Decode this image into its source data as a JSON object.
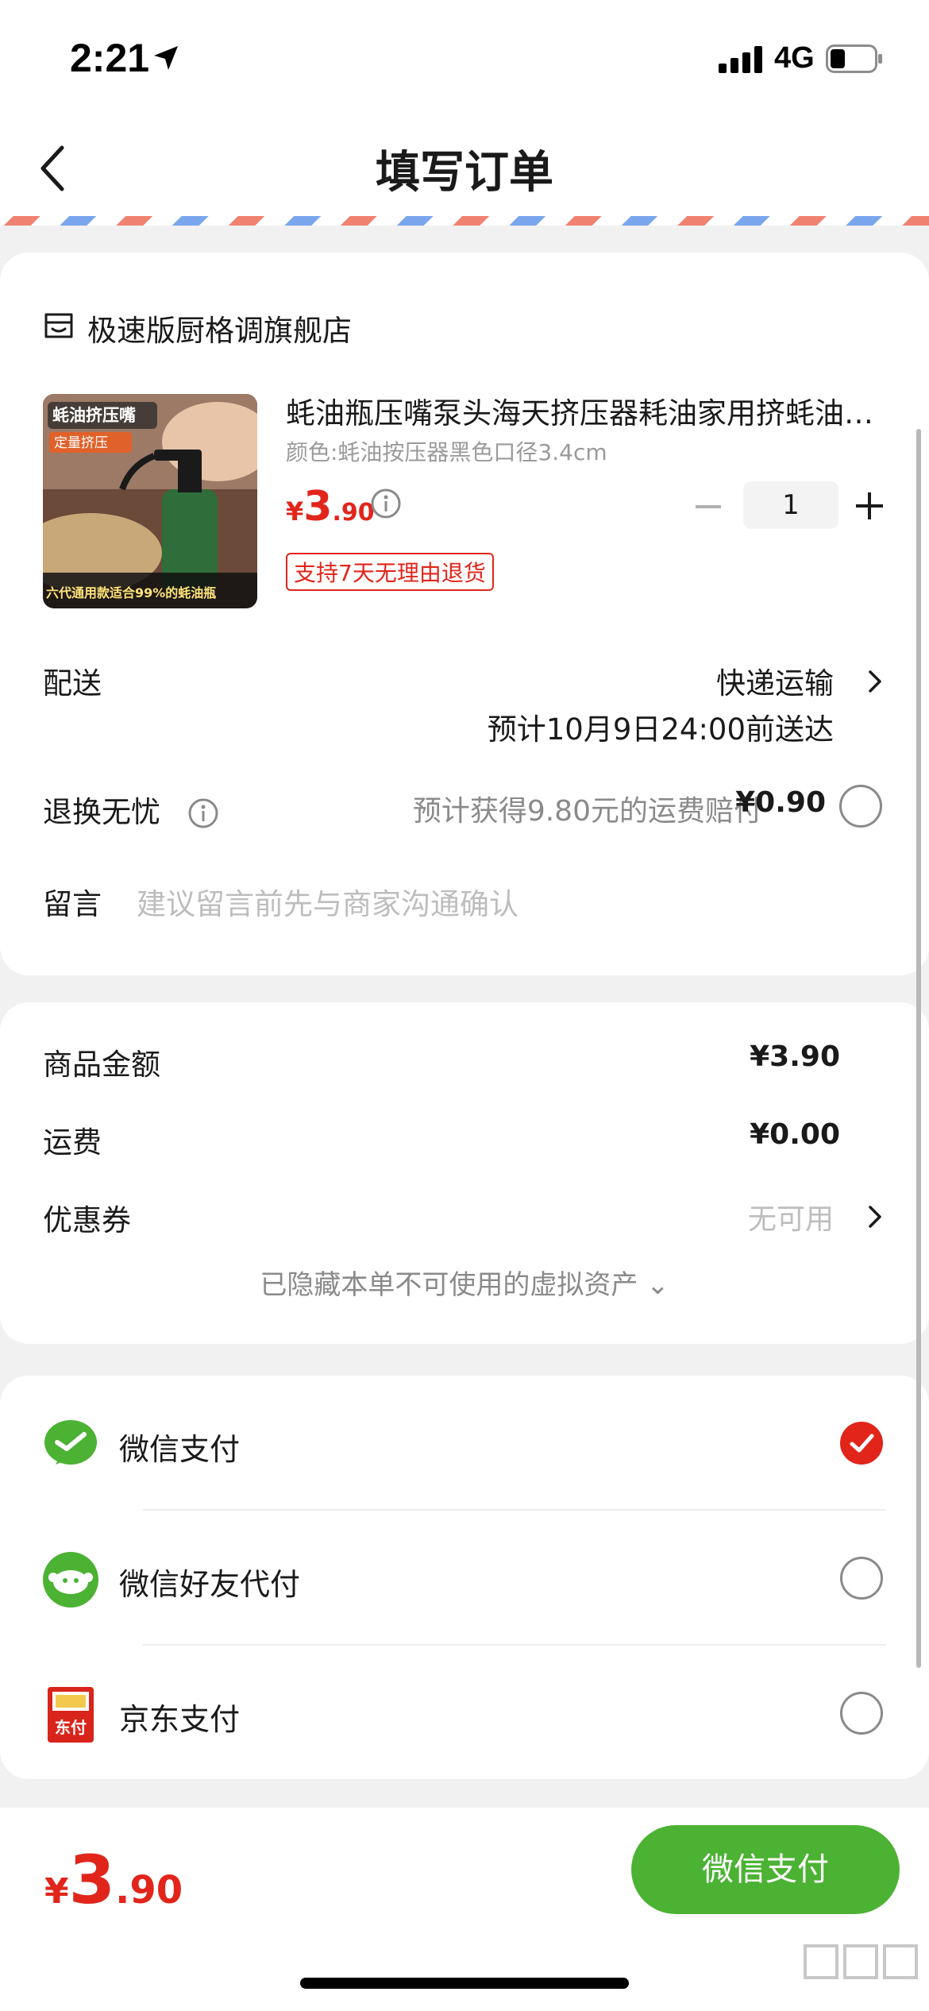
{
  "status_bar": {
    "time": "2:21",
    "network": "4G"
  },
  "nav": {
    "title": "填写订单"
  },
  "shop": {
    "name": "极速版厨格调旗舰店"
  },
  "product": {
    "title": "蚝油瓶压嘴泵头海天挤压器耗油家用挤蚝油神器",
    "spec": "颜色:蚝油按压器黑色口径3.4cm",
    "price_symbol": "¥",
    "price_int": "3",
    "price_dec": ".90",
    "quantity": "1",
    "return_tag": "支持7天无理由退货",
    "image_texts": {
      "badge1": "蚝油挤压嘴",
      "badge2": "定量挤压",
      "footer": "六代通用款适合99%的蚝油瓶"
    }
  },
  "delivery": {
    "label": "配送",
    "method": "快递运输",
    "eta": "预计10月9日24:00前送达"
  },
  "return_worry": {
    "label": "退换无忧",
    "text": "预计获得9.80元的运费赔付",
    "price": "¥0.90"
  },
  "message": {
    "label": "留言",
    "placeholder": "建议留言前先与商家沟通确认"
  },
  "costs": {
    "goods_label": "商品金额",
    "goods_value": "¥3.90",
    "shipping_label": "运费",
    "shipping_value": "¥0.00",
    "coupon_label": "优惠券",
    "coupon_value": "无可用",
    "hidden_assets": "已隐藏本单不可使用的虚拟资产 ⌄"
  },
  "payment_methods": [
    {
      "label": "微信支付",
      "selected": true
    },
    {
      "label": "微信好友代付",
      "selected": false
    },
    {
      "label": "京东支付",
      "selected": false
    }
  ],
  "jd_icon_text": "东付",
  "footer": {
    "total_symbol": "¥",
    "total_int": "3",
    "total_dec": ".90",
    "pay_button": "微信支付"
  },
  "colors": {
    "accent_red": "#e1251b",
    "wechat_green": "#4cb234"
  },
  "icons": [
    "location-arrow-icon",
    "signal-icon",
    "battery-icon",
    "back-chevron-icon",
    "shop-icon",
    "info-icon",
    "minus-icon",
    "plus-icon",
    "chevron-right-icon",
    "check-icon",
    "wechat-pay-icon",
    "wechat-friend-pay-icon",
    "jd-pay-icon"
  ]
}
